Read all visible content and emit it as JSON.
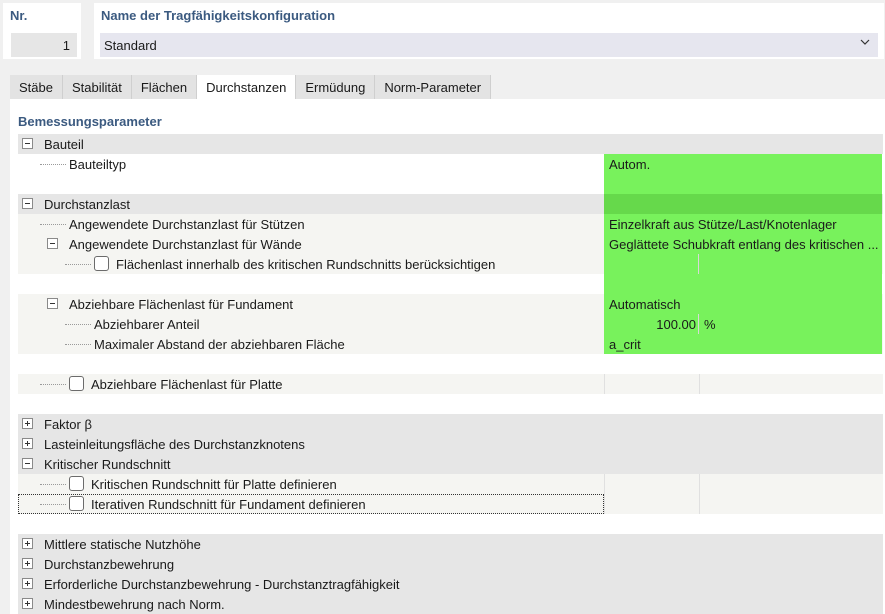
{
  "header": {
    "nr_label": "Nr.",
    "nr_value": "1",
    "name_label": "Name der Tragfähigkeitskonfiguration",
    "name_value": "Standard"
  },
  "tabs": [
    {
      "label": "Stäbe",
      "active": false
    },
    {
      "label": "Stabilität",
      "active": false
    },
    {
      "label": "Flächen",
      "active": false
    },
    {
      "label": "Durchstanzen",
      "active": true
    },
    {
      "label": "Ermüdung",
      "active": false
    },
    {
      "label": "Norm-Parameter",
      "active": false
    }
  ],
  "section_title": "Bemessungsparameter",
  "tree": {
    "bauteil": "Bauteil",
    "bauteiltyp": {
      "label": "Bauteiltyp",
      "value": "Autom."
    },
    "durchstanzlast": "Durchstanzlast",
    "stuetzen": {
      "label": "Angewendete Durchstanzlast für Stützen",
      "value": "Einzelkraft aus Stütze/Last/Knotenlager"
    },
    "waende": {
      "label": "Angewendete Durchstanzlast für Wände",
      "value": "Geglättete Schubkraft entlang des kritischen ..."
    },
    "flaechenlast_krit": {
      "label": "Flächenlast innerhalb des kritischen Rundschnitts berücksichtigen",
      "checked": false
    },
    "fundament": {
      "label": "Abziehbare Flächenlast für Fundament",
      "value": "Automatisch"
    },
    "anteil": {
      "label": "Abziehbarer Anteil",
      "value": "100.00",
      "unit": "%"
    },
    "abstand": {
      "label": "Maximaler Abstand der abziehbaren Fläche",
      "value": "a_crit"
    },
    "platte": {
      "label": "Abziehbare Flächenlast für Platte",
      "checked": false
    },
    "faktor": "Faktor β",
    "lasteinleitung": "Lasteinleitungsfläche des Durchstanzknotens",
    "kritischer": "Kritischer Rundschnitt",
    "krit_platte": {
      "label": "Kritischen Rundschnitt für Platte definieren",
      "checked": false
    },
    "iterativ": {
      "label": "Iterativen Rundschnitt für Fundament definieren",
      "checked": false
    },
    "nutzhoehe": "Mittlere statische Nutzhöhe",
    "bewehrung": "Durchstanzbewehrung",
    "erforderlich": "Erforderliche Durchstanzbewehrung - Durchstanztragfähigkeit",
    "mindest": "Mindestbewehrung nach Norm."
  },
  "colors": {
    "value_highlight": "#78f25c",
    "header_label": "#3b5a80",
    "group_row": "#e6e6e6"
  }
}
